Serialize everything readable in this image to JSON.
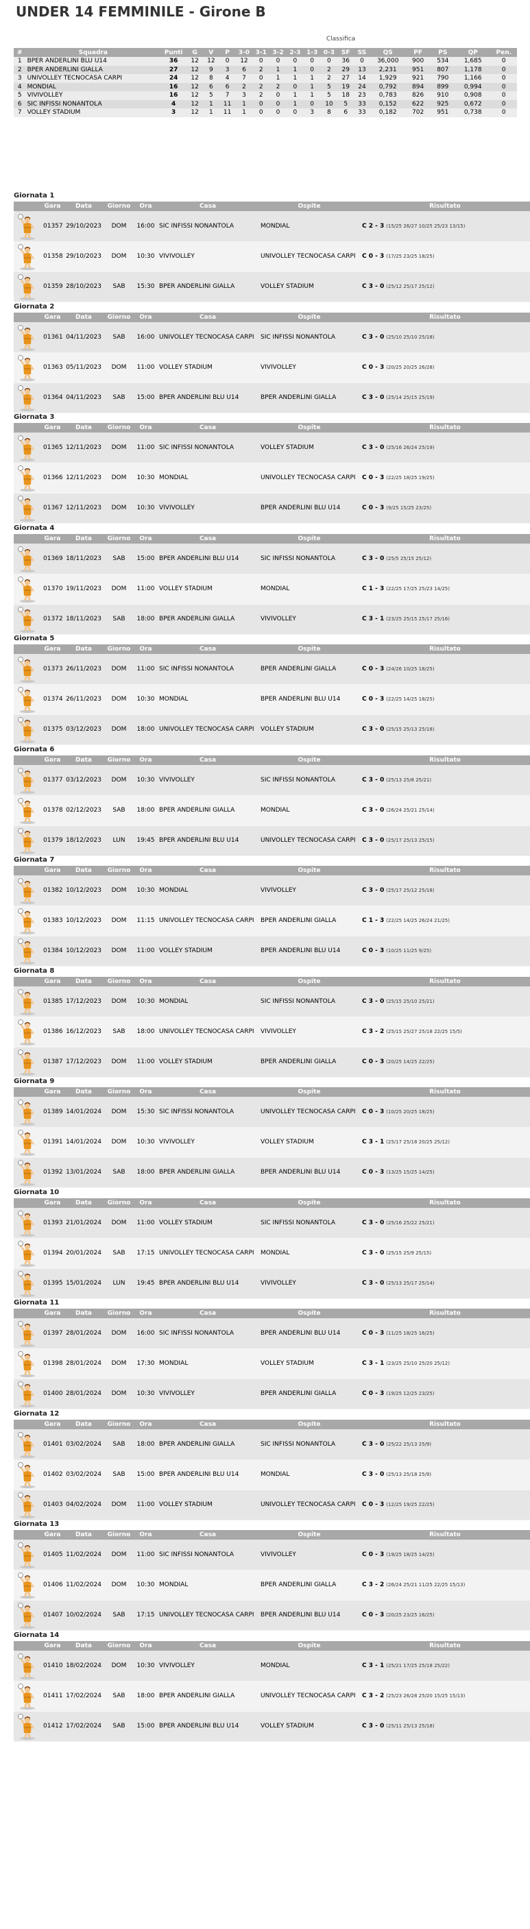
{
  "title": "UNDER 14 FEMMINILE - Girone B",
  "standings": {
    "caption": "Classifica",
    "headers": [
      "#",
      "Squadra",
      "Punti",
      "G",
      "V",
      "P",
      "3-0",
      "3-1",
      "3-2",
      "2-3",
      "1-3",
      "0-3",
      "SF",
      "SS",
      "QS",
      "PF",
      "PS",
      "QP",
      "Pen."
    ],
    "rows": [
      [
        "1",
        "BPER ANDERLINI BLU U14",
        "36",
        "12",
        "12",
        "0",
        "12",
        "0",
        "0",
        "0",
        "0",
        "0",
        "36",
        "0",
        "36,000",
        "900",
        "534",
        "1,685",
        "0"
      ],
      [
        "2",
        "BPER ANDERLINI GIALLA",
        "27",
        "12",
        "9",
        "3",
        "6",
        "2",
        "1",
        "1",
        "0",
        "2",
        "29",
        "13",
        "2,231",
        "951",
        "807",
        "1,178",
        "0"
      ],
      [
        "3",
        "UNIVOLLEY TECNOCASA CARPI",
        "24",
        "12",
        "8",
        "4",
        "7",
        "0",
        "1",
        "1",
        "1",
        "2",
        "27",
        "14",
        "1,929",
        "921",
        "790",
        "1,166",
        "0"
      ],
      [
        "4",
        "MONDIAL",
        "16",
        "12",
        "6",
        "6",
        "2",
        "2",
        "2",
        "0",
        "1",
        "5",
        "19",
        "24",
        "0,792",
        "894",
        "899",
        "0,994",
        "0"
      ],
      [
        "5",
        "VIVIVOLLEY",
        "16",
        "12",
        "5",
        "7",
        "3",
        "2",
        "0",
        "1",
        "1",
        "5",
        "18",
        "23",
        "0,783",
        "826",
        "910",
        "0,908",
        "0"
      ],
      [
        "6",
        "SIC INFISSI NONANTOLA",
        "4",
        "12",
        "1",
        "11",
        "1",
        "0",
        "0",
        "1",
        "0",
        "10",
        "5",
        "33",
        "0,152",
        "622",
        "925",
        "0,672",
        "0"
      ],
      [
        "7",
        "VOLLEY STADIUM",
        "3",
        "12",
        "1",
        "11",
        "1",
        "0",
        "0",
        "0",
        "3",
        "8",
        "6",
        "33",
        "0,182",
        "702",
        "951",
        "0,738",
        "0"
      ]
    ]
  },
  "match_headers": [
    "",
    "Gara",
    "Data",
    "Giorno",
    "Ora",
    "Casa",
    "Ospite",
    "Risultato"
  ],
  "rounds": [
    {
      "title": "Giornata 1",
      "matches": [
        {
          "gara": "01357",
          "data": "29/10/2023",
          "giorno": "DOM",
          "ora": "16:00",
          "casa": "SIC INFISSI NONANTOLA",
          "ospite": "MONDIAL",
          "risultato": "C 2 - 3",
          "sets": "(15/25 26/27 10/25 25/23 13/15)"
        },
        {
          "gara": "01358",
          "data": "29/10/2023",
          "giorno": "DOM",
          "ora": "10:30",
          "casa": "VIVIVOLLEY",
          "ospite": "UNIVOLLEY TECNOCASA CARPI",
          "risultato": "C 0 - 3",
          "sets": "(17/25 23/25 18/25)"
        },
        {
          "gara": "01359",
          "data": "28/10/2023",
          "giorno": "SAB",
          "ora": "15:30",
          "casa": "BPER ANDERLINI GIALLA",
          "ospite": "VOLLEY STADIUM",
          "risultato": "C 3 - 0",
          "sets": "(25/12 25/17 25/12)"
        }
      ]
    },
    {
      "title": "Giornata 2",
      "matches": [
        {
          "gara": "01361",
          "data": "04/11/2023",
          "giorno": "SAB",
          "ora": "16:00",
          "casa": "UNIVOLLEY TECNOCASA CARPI",
          "ospite": "SIC INFISSI NONANTOLA",
          "risultato": "C 3 - 0",
          "sets": "(25/10 25/10 25/18)"
        },
        {
          "gara": "01363",
          "data": "05/11/2023",
          "giorno": "DOM",
          "ora": "11:00",
          "casa": "VOLLEY STADIUM",
          "ospite": "VIVIVOLLEY",
          "risultato": "C 0 - 3",
          "sets": "(20/25 20/25 26/28)"
        },
        {
          "gara": "01364",
          "data": "04/11/2023",
          "giorno": "SAB",
          "ora": "15:00",
          "casa": "BPER ANDERLINI BLU U14",
          "ospite": "BPER ANDERLINI GIALLA",
          "risultato": "C 3 - 0",
          "sets": "(25/14 25/15 25/19)"
        }
      ]
    },
    {
      "title": "Giornata 3",
      "matches": [
        {
          "gara": "01365",
          "data": "12/11/2023",
          "giorno": "DOM",
          "ora": "11:00",
          "casa": "SIC INFISSI NONANTOLA",
          "ospite": "VOLLEY STADIUM",
          "risultato": "C 3 - 0",
          "sets": "(25/16 26/24 25/19)"
        },
        {
          "gara": "01366",
          "data": "12/11/2023",
          "giorno": "DOM",
          "ora": "10:30",
          "casa": "MONDIAL",
          "ospite": "UNIVOLLEY TECNOCASA CARPI",
          "risultato": "C 0 - 3",
          "sets": "(22/25 18/25 19/25)"
        },
        {
          "gara": "01367",
          "data": "12/11/2023",
          "giorno": "DOM",
          "ora": "10:30",
          "casa": "VIVIVOLLEY",
          "ospite": "BPER ANDERLINI BLU U14",
          "risultato": "C 0 - 3",
          "sets": "(9/25 15/25 23/25)"
        }
      ]
    },
    {
      "title": "Giornata 4",
      "matches": [
        {
          "gara": "01369",
          "data": "18/11/2023",
          "giorno": "SAB",
          "ora": "15:00",
          "casa": "BPER ANDERLINI BLU U14",
          "ospite": "SIC INFISSI NONANTOLA",
          "risultato": "C 3 - 0",
          "sets": "(25/5 25/15 25/12)"
        },
        {
          "gara": "01370",
          "data": "19/11/2023",
          "giorno": "DOM",
          "ora": "11:00",
          "casa": "VOLLEY STADIUM",
          "ospite": "MONDIAL",
          "risultato": "C 1 - 3",
          "sets": "(22/25 17/25 25/23 14/25)"
        },
        {
          "gara": "01372",
          "data": "18/11/2023",
          "giorno": "SAB",
          "ora": "18:00",
          "casa": "BPER ANDERLINI GIALLA",
          "ospite": "VIVIVOLLEY",
          "risultato": "C 3 - 1",
          "sets": "(23/25 25/15 25/17 25/16)"
        }
      ]
    },
    {
      "title": "Giornata 5",
      "matches": [
        {
          "gara": "01373",
          "data": "26/11/2023",
          "giorno": "DOM",
          "ora": "11:00",
          "casa": "SIC INFISSI NONANTOLA",
          "ospite": "BPER ANDERLINI GIALLA",
          "risultato": "C 0 - 3",
          "sets": "(24/26 10/25 18/25)"
        },
        {
          "gara": "01374",
          "data": "26/11/2023",
          "giorno": "DOM",
          "ora": "10:30",
          "casa": "MONDIAL",
          "ospite": "BPER ANDERLINI BLU U14",
          "risultato": "C 0 - 3",
          "sets": "(22/25 14/25 18/25)"
        },
        {
          "gara": "01375",
          "data": "03/12/2023",
          "giorno": "DOM",
          "ora": "18:00",
          "casa": "UNIVOLLEY TECNOCASA CARPI",
          "ospite": "VOLLEY STADIUM",
          "risultato": "C 3 - 0",
          "sets": "(25/15 25/13 25/18)"
        }
      ]
    },
    {
      "title": "Giornata 6",
      "matches": [
        {
          "gara": "01377",
          "data": "03/12/2023",
          "giorno": "DOM",
          "ora": "10:30",
          "casa": "VIVIVOLLEY",
          "ospite": "SIC INFISSI NONANTOLA",
          "risultato": "C 3 - 0",
          "sets": "(25/13 25/8 25/21)"
        },
        {
          "gara": "01378",
          "data": "02/12/2023",
          "giorno": "SAB",
          "ora": "18:00",
          "casa": "BPER ANDERLINI GIALLA",
          "ospite": "MONDIAL",
          "risultato": "C 3 - 0",
          "sets": "(26/24 25/21 25/14)"
        },
        {
          "gara": "01379",
          "data": "18/12/2023",
          "giorno": "LUN",
          "ora": "19:45",
          "casa": "BPER ANDERLINI BLU U14",
          "ospite": "UNIVOLLEY TECNOCASA CARPI",
          "risultato": "C 3 - 0",
          "sets": "(25/17 25/13 25/15)"
        }
      ]
    },
    {
      "title": "Giornata 7",
      "matches": [
        {
          "gara": "01382",
          "data": "10/12/2023",
          "giorno": "DOM",
          "ora": "10:30",
          "casa": "MONDIAL",
          "ospite": "VIVIVOLLEY",
          "risultato": "C 3 - 0",
          "sets": "(25/17 25/12 25/18)"
        },
        {
          "gara": "01383",
          "data": "10/12/2023",
          "giorno": "DOM",
          "ora": "11:15",
          "casa": "UNIVOLLEY TECNOCASA CARPI",
          "ospite": "BPER ANDERLINI GIALLA",
          "risultato": "C 1 - 3",
          "sets": "(22/25 14/25 26/24 21/25)"
        },
        {
          "gara": "01384",
          "data": "10/12/2023",
          "giorno": "DOM",
          "ora": "11:00",
          "casa": "VOLLEY STADIUM",
          "ospite": "BPER ANDERLINI BLU U14",
          "risultato": "C 0 - 3",
          "sets": "(10/25 11/25 9/25)"
        }
      ]
    },
    {
      "title": "Giornata 8",
      "matches": [
        {
          "gara": "01385",
          "data": "17/12/2023",
          "giorno": "DOM",
          "ora": "10:30",
          "casa": "MONDIAL",
          "ospite": "SIC INFISSI NONANTOLA",
          "risultato": "C 3 - 0",
          "sets": "(25/15 25/10 25/21)"
        },
        {
          "gara": "01386",
          "data": "16/12/2023",
          "giorno": "SAB",
          "ora": "18:00",
          "casa": "UNIVOLLEY TECNOCASA CARPI",
          "ospite": "VIVIVOLLEY",
          "risultato": "C 3 - 2",
          "sets": "(25/15 25/27 25/18 22/25 15/5)"
        },
        {
          "gara": "01387",
          "data": "17/12/2023",
          "giorno": "DOM",
          "ora": "11:00",
          "casa": "VOLLEY STADIUM",
          "ospite": "BPER ANDERLINI GIALLA",
          "risultato": "C 0 - 3",
          "sets": "(20/25 14/25 22/25)"
        }
      ]
    },
    {
      "title": "Giornata 9",
      "matches": [
        {
          "gara": "01389",
          "data": "14/01/2024",
          "giorno": "DOM",
          "ora": "15:30",
          "casa": "SIC INFISSI NONANTOLA",
          "ospite": "UNIVOLLEY TECNOCASA CARPI",
          "risultato": "C 0 - 3",
          "sets": "(10/25 20/25 18/25)"
        },
        {
          "gara": "01391",
          "data": "14/01/2024",
          "giorno": "DOM",
          "ora": "10:30",
          "casa": "VIVIVOLLEY",
          "ospite": "VOLLEY STADIUM",
          "risultato": "C 3 - 1",
          "sets": "(25/17 25/18 20/25 25/12)"
        },
        {
          "gara": "01392",
          "data": "13/01/2024",
          "giorno": "SAB",
          "ora": "18:00",
          "casa": "BPER ANDERLINI GIALLA",
          "ospite": "BPER ANDERLINI BLU U14",
          "risultato": "C 0 - 3",
          "sets": "(13/25 15/25 14/25)"
        }
      ]
    },
    {
      "title": "Giornata 10",
      "matches": [
        {
          "gara": "01393",
          "data": "21/01/2024",
          "giorno": "DOM",
          "ora": "11:00",
          "casa": "VOLLEY STADIUM",
          "ospite": "SIC INFISSI NONANTOLA",
          "risultato": "C 3 - 0",
          "sets": "(25/16 25/22 25/21)"
        },
        {
          "gara": "01394",
          "data": "20/01/2024",
          "giorno": "SAB",
          "ora": "17:15",
          "casa": "UNIVOLLEY TECNOCASA CARPI",
          "ospite": "MONDIAL",
          "risultato": "C 3 - 0",
          "sets": "(25/15 25/9 25/15)"
        },
        {
          "gara": "01395",
          "data": "15/01/2024",
          "giorno": "LUN",
          "ora": "19:45",
          "casa": "BPER ANDERLINI BLU U14",
          "ospite": "VIVIVOLLEY",
          "risultato": "C 3 - 0",
          "sets": "(25/13 25/17 25/14)"
        }
      ]
    },
    {
      "title": "Giornata 11",
      "matches": [
        {
          "gara": "01397",
          "data": "28/01/2024",
          "giorno": "DOM",
          "ora": "16:00",
          "casa": "SIC INFISSI NONANTOLA",
          "ospite": "BPER ANDERLINI BLU U14",
          "risultato": "C 0 - 3",
          "sets": "(11/25 18/25 16/25)"
        },
        {
          "gara": "01398",
          "data": "28/01/2024",
          "giorno": "DOM",
          "ora": "17:30",
          "casa": "MONDIAL",
          "ospite": "VOLLEY STADIUM",
          "risultato": "C 3 - 1",
          "sets": "(23/25 25/10 25/20 25/12)"
        },
        {
          "gara": "01400",
          "data": "28/01/2024",
          "giorno": "DOM",
          "ora": "10:30",
          "casa": "VIVIVOLLEY",
          "ospite": "BPER ANDERLINI GIALLA",
          "risultato": "C 0 - 3",
          "sets": "(19/25 12/25 23/25)"
        }
      ]
    },
    {
      "title": "Giornata 12",
      "matches": [
        {
          "gara": "01401",
          "data": "03/02/2024",
          "giorno": "SAB",
          "ora": "18:00",
          "casa": "BPER ANDERLINI GIALLA",
          "ospite": "SIC INFISSI NONANTOLA",
          "risultato": "C 3 - 0",
          "sets": "(25/22 25/13 25/9)"
        },
        {
          "gara": "01402",
          "data": "03/02/2024",
          "giorno": "SAB",
          "ora": "15:00",
          "casa": "BPER ANDERLINI BLU U14",
          "ospite": "MONDIAL",
          "risultato": "C 3 - 0",
          "sets": "(25/13 25/18 25/9)"
        },
        {
          "gara": "01403",
          "data": "04/02/2024",
          "giorno": "DOM",
          "ora": "11:00",
          "casa": "VOLLEY STADIUM",
          "ospite": "UNIVOLLEY TECNOCASA CARPI",
          "risultato": "C 0 - 3",
          "sets": "(12/25 19/25 22/25)"
        }
      ]
    },
    {
      "title": "Giornata 13",
      "matches": [
        {
          "gara": "01405",
          "data": "11/02/2024",
          "giorno": "DOM",
          "ora": "11:00",
          "casa": "SIC INFISSI NONANTOLA",
          "ospite": "VIVIVOLLEY",
          "risultato": "C 0 - 3",
          "sets": "(19/25 18/25 14/25)"
        },
        {
          "gara": "01406",
          "data": "11/02/2024",
          "giorno": "DOM",
          "ora": "10:30",
          "casa": "MONDIAL",
          "ospite": "BPER ANDERLINI GIALLA",
          "risultato": "C 3 - 2",
          "sets": "(26/24 25/21 11/25 22/25 15/13)"
        },
        {
          "gara": "01407",
          "data": "10/02/2024",
          "giorno": "SAB",
          "ora": "17:15",
          "casa": "UNIVOLLEY TECNOCASA CARPI",
          "ospite": "BPER ANDERLINI BLU U14",
          "risultato": "C 0 - 3",
          "sets": "(20/25 23/25 16/25)"
        }
      ]
    },
    {
      "title": "Giornata 14",
      "matches": [
        {
          "gara": "01410",
          "data": "18/02/2024",
          "giorno": "DOM",
          "ora": "10:30",
          "casa": "VIVIVOLLEY",
          "ospite": "MONDIAL",
          "risultato": "C 3 - 1",
          "sets": "(25/21 17/25 25/18 25/22)"
        },
        {
          "gara": "01411",
          "data": "17/02/2024",
          "giorno": "SAB",
          "ora": "18:00",
          "casa": "BPER ANDERLINI GIALLA",
          "ospite": "UNIVOLLEY TECNOCASA CARPI",
          "risultato": "C 3 - 2",
          "sets": "(25/23 26/28 25/20 15/25 15/13)"
        },
        {
          "gara": "01412",
          "data": "17/02/2024",
          "giorno": "SAB",
          "ora": "15:00",
          "casa": "BPER ANDERLINI BLU U14",
          "ospite": "VOLLEY STADIUM",
          "risultato": "C 3 - 0",
          "sets": "(25/11 25/13 25/18)"
        }
      ]
    }
  ]
}
